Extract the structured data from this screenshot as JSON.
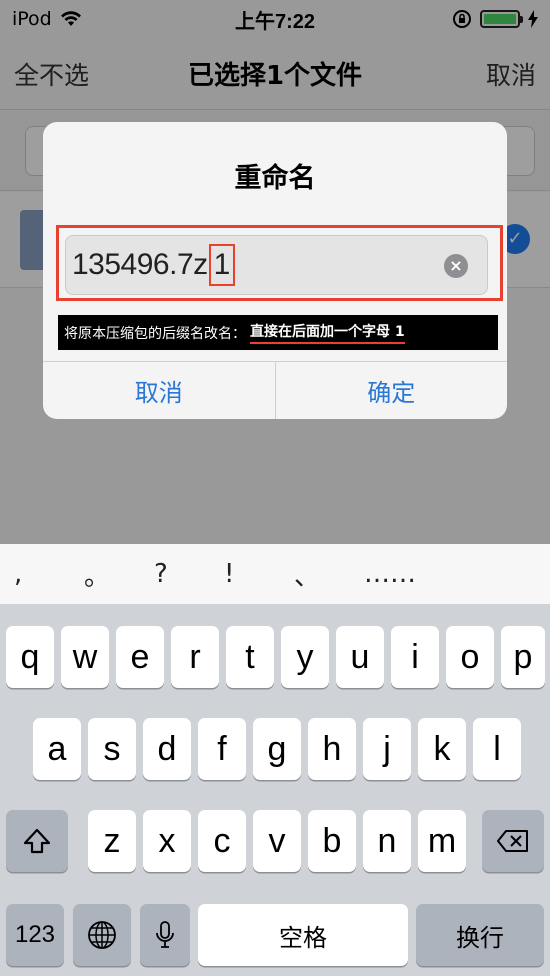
{
  "status": {
    "carrier": "iPod",
    "time": "上午7:22"
  },
  "nav": {
    "left": "全不选",
    "title": "已选择1个文件",
    "right": "取消"
  },
  "dialog": {
    "title": "重命名",
    "input_value": "135496.7z",
    "input_highlight": "1",
    "note_text": "将原本压缩包的后缀名改名：",
    "note_emph": "直接在后面加一个字母 1",
    "cancel": "取消",
    "confirm": "确定"
  },
  "punctuation": [
    ",",
    "。",
    "?",
    "!",
    "、",
    "……"
  ],
  "keyboard": {
    "row1": [
      "q",
      "w",
      "e",
      "r",
      "t",
      "y",
      "u",
      "i",
      "o",
      "p"
    ],
    "row2": [
      "a",
      "s",
      "d",
      "f",
      "g",
      "h",
      "j",
      "k",
      "l"
    ],
    "row3": [
      "z",
      "x",
      "c",
      "v",
      "b",
      "n",
      "m"
    ],
    "num": "123",
    "space": "空格",
    "return": "换行"
  },
  "icons": {
    "wifi": "wifi-icon",
    "lock": "rotation-lock-icon",
    "battery": "battery-icon",
    "charge": "charging-icon",
    "shift": "shift-icon",
    "delete": "delete-icon",
    "globe": "globe-icon",
    "mic": "microphone-icon",
    "clear": "clear-icon"
  }
}
